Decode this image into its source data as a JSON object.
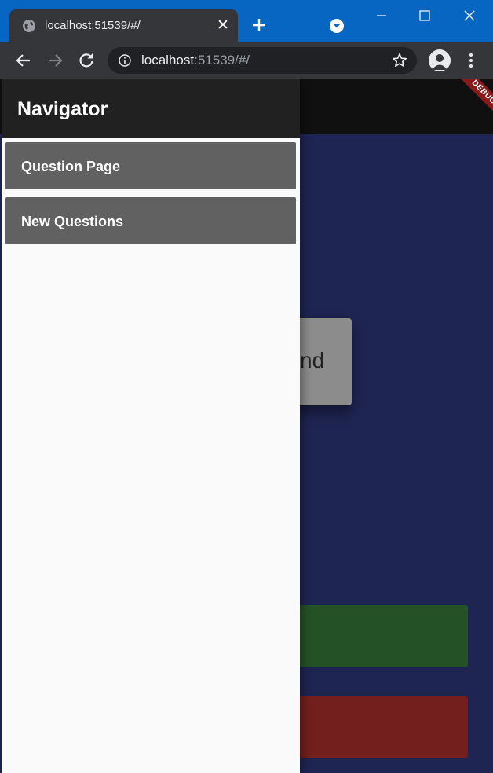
{
  "browser": {
    "tab": {
      "title": "localhost:51539/#/",
      "close_glyph": "✕",
      "icon": "globe-icon"
    },
    "new_tab_icon": "plus-icon",
    "profile_menu_icon": "chevron-down-circle-icon",
    "window_controls": {
      "minimize_icon": "minimize-icon",
      "maximize_icon": "maximize-icon",
      "close_icon": "close-icon"
    },
    "toolbar": {
      "back_icon": "arrow-left-icon",
      "forward_icon": "arrow-right-icon",
      "reload_icon": "reload-icon",
      "menu_icon": "kebab-menu-icon"
    },
    "omnibox": {
      "url_host": "localhost",
      "url_rest": ":51539/#/",
      "info_icon": "info-icon",
      "bookmark_icon": "star-icon"
    },
    "avatar_icon": "person-icon",
    "colors": {
      "titlebar": "#0766c2",
      "tab": "#35363a",
      "toolbar": "#35363a",
      "omnibox": "#202124"
    }
  },
  "app": {
    "debug_banner": "DEBUG",
    "background_card_text": "nd",
    "colors": {
      "page_background": "#1e2552",
      "appbar": "#101010",
      "green_button": "#245126",
      "red_button": "#731f1d"
    }
  },
  "drawer": {
    "title": "Navigator",
    "items": [
      {
        "label": "Question Page"
      },
      {
        "label": "New Questions"
      }
    ],
    "colors": {
      "header": "#212121",
      "item": "#616161",
      "body": "#fafafa"
    }
  }
}
